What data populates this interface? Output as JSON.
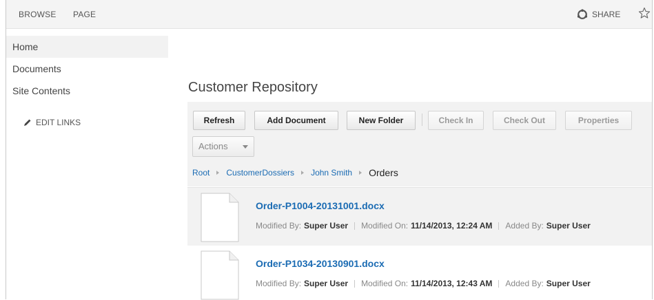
{
  "ribbon": {
    "tabs": [
      "BROWSE",
      "PAGE"
    ],
    "share_label": "SHARE"
  },
  "nav": {
    "items": [
      "Home",
      "Documents",
      "Site Contents"
    ],
    "edit_links_label": "EDIT LINKS"
  },
  "main": {
    "title": "Customer Repository",
    "toolbar": {
      "refresh": "Refresh",
      "add_document": "Add Document",
      "new_folder": "New Folder",
      "check_in": "Check In",
      "check_out": "Check Out",
      "properties": "Properties",
      "actions": "Actions"
    },
    "breadcrumb": [
      "Root",
      "CustomerDossiers",
      "John Smith",
      "Orders"
    ],
    "meta_labels": {
      "modified_by": "Modified By:",
      "modified_on": "Modified On:",
      "added_by": "Added By:"
    },
    "documents": [
      {
        "name": "Order-P1004-20131001.docx",
        "modified_by": "Super User",
        "modified_on": "11/14/2013, 12:24 AM",
        "added_by": "Super User"
      },
      {
        "name": "Order-P1034-20130901.docx",
        "modified_by": "Super User",
        "modified_on": "11/14/2013, 12:43 AM",
        "added_by": "Super User"
      }
    ]
  }
}
